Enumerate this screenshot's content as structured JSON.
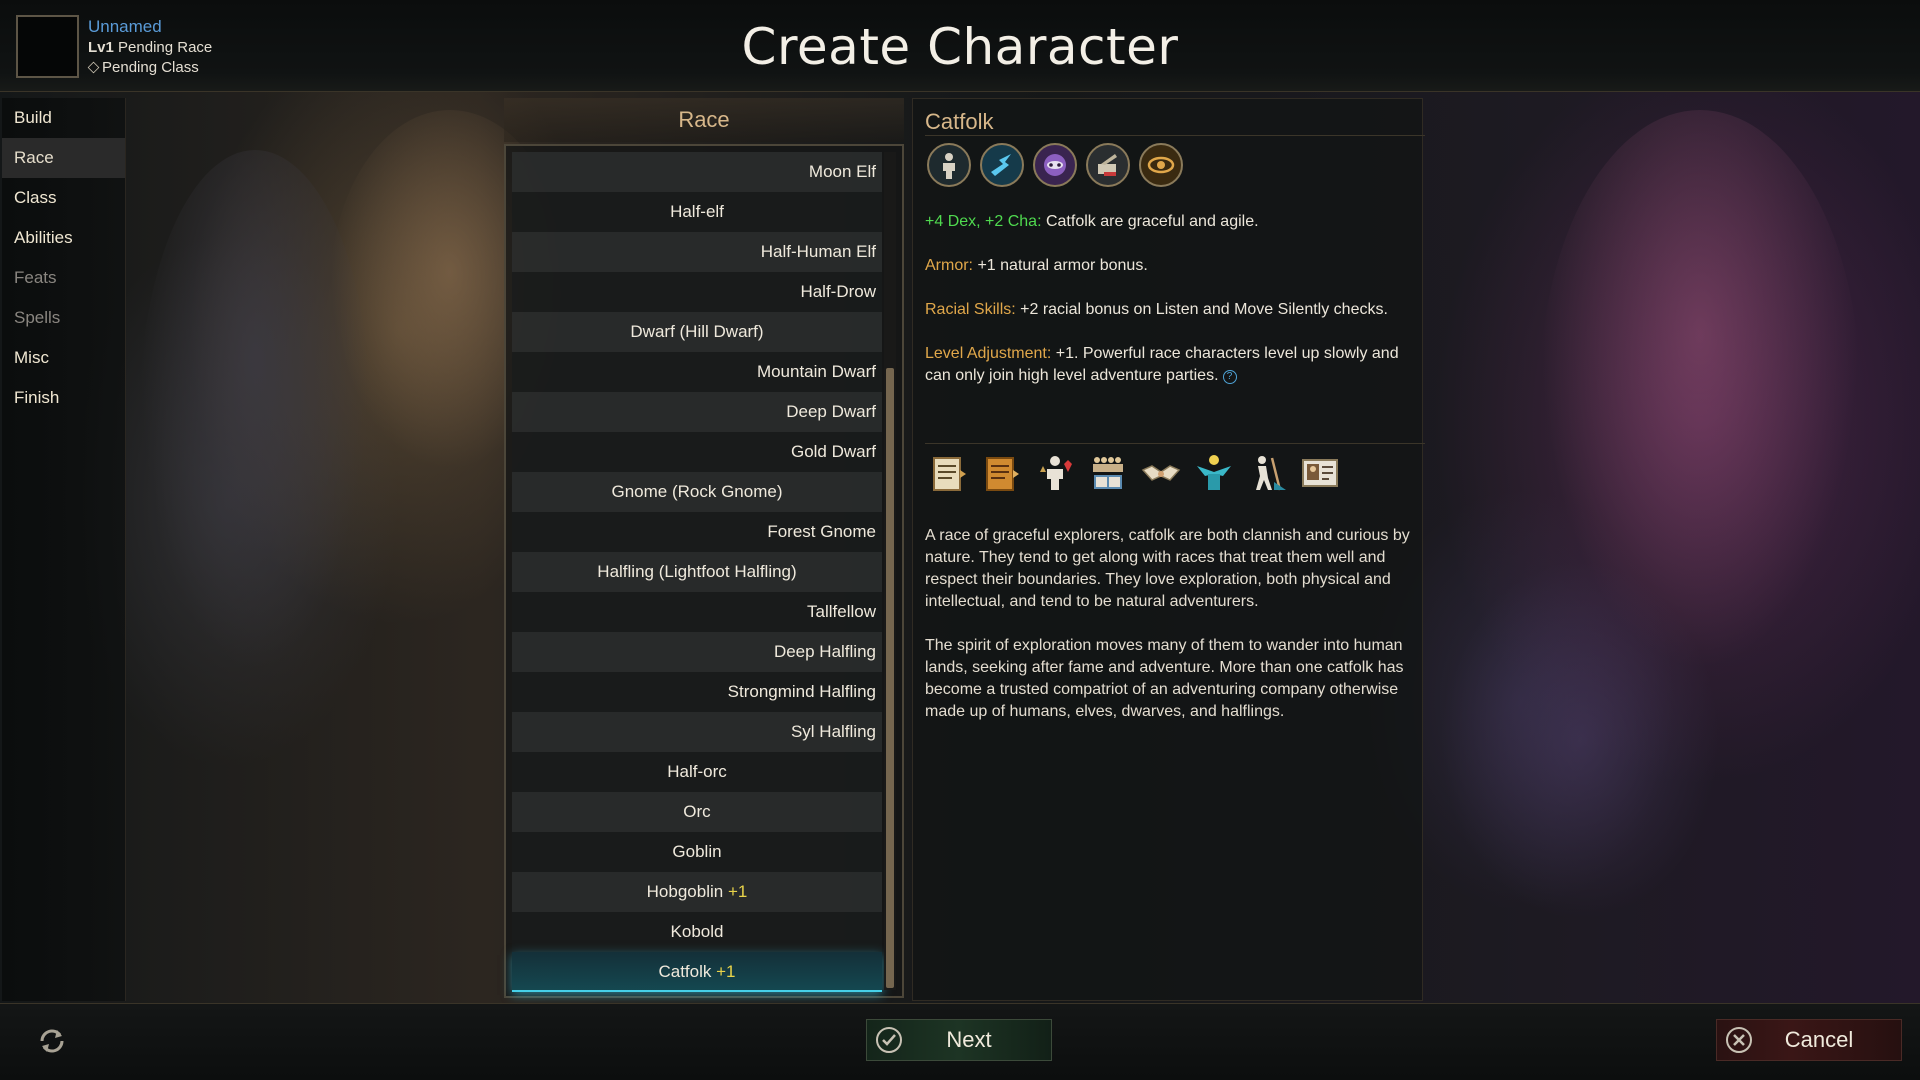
{
  "header": {
    "title": "Create Character",
    "char_name": "Unnamed",
    "level_prefix": "Lv1",
    "race_status": "Pending Race",
    "class_status": "Pending Class"
  },
  "nav": {
    "items": [
      {
        "label": "Build",
        "state": "normal"
      },
      {
        "label": "Race",
        "state": "active"
      },
      {
        "label": "Class",
        "state": "normal"
      },
      {
        "label": "Abilities",
        "state": "normal"
      },
      {
        "label": "Feats",
        "state": "disabled"
      },
      {
        "label": "Spells",
        "state": "disabled"
      },
      {
        "label": "Misc",
        "state": "normal"
      },
      {
        "label": "Finish",
        "state": "normal"
      }
    ]
  },
  "race_panel": {
    "header": "Race",
    "races": [
      {
        "name": "Moon Elf",
        "plus": "",
        "align": "right"
      },
      {
        "name": "Half-elf",
        "plus": "",
        "align": "center"
      },
      {
        "name": "Half-Human Elf",
        "plus": "",
        "align": "right"
      },
      {
        "name": "Half-Drow",
        "plus": "",
        "align": "right"
      },
      {
        "name": "Dwarf (Hill Dwarf)",
        "plus": "",
        "align": "center"
      },
      {
        "name": "Mountain Dwarf",
        "plus": "",
        "align": "right"
      },
      {
        "name": "Deep Dwarf",
        "plus": "",
        "align": "right"
      },
      {
        "name": "Gold Dwarf",
        "plus": "",
        "align": "right"
      },
      {
        "name": "Gnome (Rock Gnome)",
        "plus": "",
        "align": "center"
      },
      {
        "name": "Forest Gnome",
        "plus": "",
        "align": "right"
      },
      {
        "name": "Halfling (Lightfoot Halfling)",
        "plus": "",
        "align": "center"
      },
      {
        "name": "Tallfellow",
        "plus": "",
        "align": "right"
      },
      {
        "name": "Deep Halfling",
        "plus": "",
        "align": "right"
      },
      {
        "name": "Strongmind Halfling",
        "plus": "",
        "align": "right"
      },
      {
        "name": "Syl Halfling",
        "plus": "",
        "align": "right"
      },
      {
        "name": "Half-orc",
        "plus": "",
        "align": "center"
      },
      {
        "name": "Orc",
        "plus": "",
        "align": "center"
      },
      {
        "name": "Goblin",
        "plus": "",
        "align": "center"
      },
      {
        "name": "Hobgoblin",
        "plus": "+1",
        "align": "center"
      },
      {
        "name": "Kobold",
        "plus": "",
        "align": "center"
      },
      {
        "name": "Catfolk",
        "plus": "+1",
        "align": "center",
        "selected": true
      }
    ]
  },
  "detail": {
    "name": "Catfolk",
    "race_icons": [
      "humanoid-icon",
      "dexterity-icon",
      "charisma-mask-icon",
      "skill-book-icon",
      "vision-eye-icon"
    ],
    "traits": [
      {
        "key": "+4 Dex, +2 Cha:",
        "key_color": "green",
        "text": "Catfolk are graceful and agile."
      },
      {
        "key": "Armor:",
        "key_color": "orange",
        "text": "+1 natural armor bonus."
      },
      {
        "key": "Racial Skills:",
        "key_color": "orange",
        "text": "+2 racial bonus on Listen and Move Silently checks."
      },
      {
        "key": "Level Adjustment:",
        "key_color": "orange",
        "text": "+1. Powerful race characters level up slowly and can only join high level adventure parties."
      }
    ],
    "tab_icons": [
      "description-scroll-icon",
      "lore-scroll-icon",
      "relations-icon",
      "society-icon",
      "alliance-handshake-icon",
      "religion-icon",
      "adventure-icon",
      "portrait-card-icon"
    ],
    "description": [
      "A race of graceful explorers, catfolk are both clannish and curious by nature. They tend to get along with races that treat them well and respect their boundaries. They love exploration, both physical and intellectual, and tend to be natural adventurers.",
      "The spirit of exploration moves many of them to wander into human lands, seeking after fame and adventure. More than one catfolk has become a trusted compatriot of an adventuring company otherwise made up of humans, elves, dwarves, and halflings."
    ]
  },
  "footer": {
    "next_label": "Next",
    "cancel_label": "Cancel",
    "refresh_icon": "refresh-icon"
  },
  "colors": {
    "accent_gold": "#d7b78a",
    "plus_yellow": "#e8d34a",
    "trait_green": "#4fd94f",
    "trait_orange": "#e0a74a",
    "name_blue": "#5a9bd8",
    "selection_cyan": "#46d0e8"
  }
}
